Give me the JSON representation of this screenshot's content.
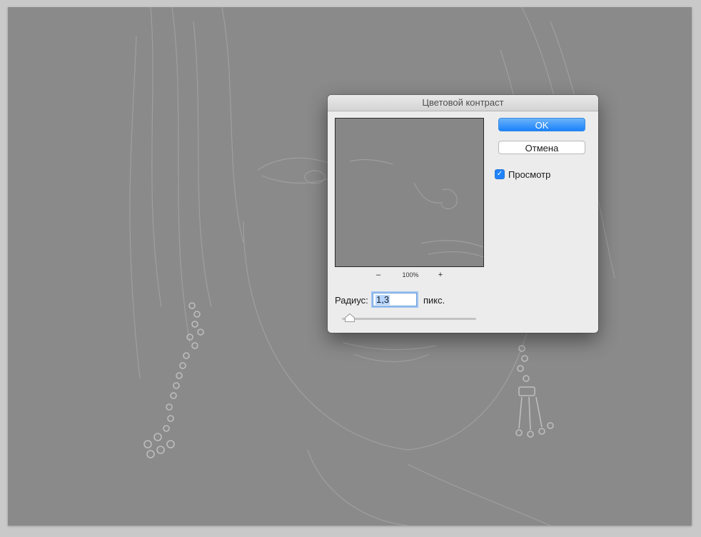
{
  "dialog": {
    "title": "Цветовой контраст",
    "ok_label": "OK",
    "cancel_label": "Отмена",
    "preview_checkbox": {
      "label": "Просмотр",
      "checked": true
    }
  },
  "preview": {
    "zoom_out": "–",
    "zoom_level": "100%",
    "zoom_in": "+"
  },
  "radius": {
    "label": "Радиус:",
    "value": "1,3",
    "unit": "пикс.",
    "slider_fraction": 0.06
  },
  "colors": {
    "accent": "#1a82fb",
    "canvas_background": "#c9c9c9",
    "image_gray": "#8a8a8a"
  },
  "icons": [
    "checkmark-icon",
    "slider-thumb-icon"
  ]
}
